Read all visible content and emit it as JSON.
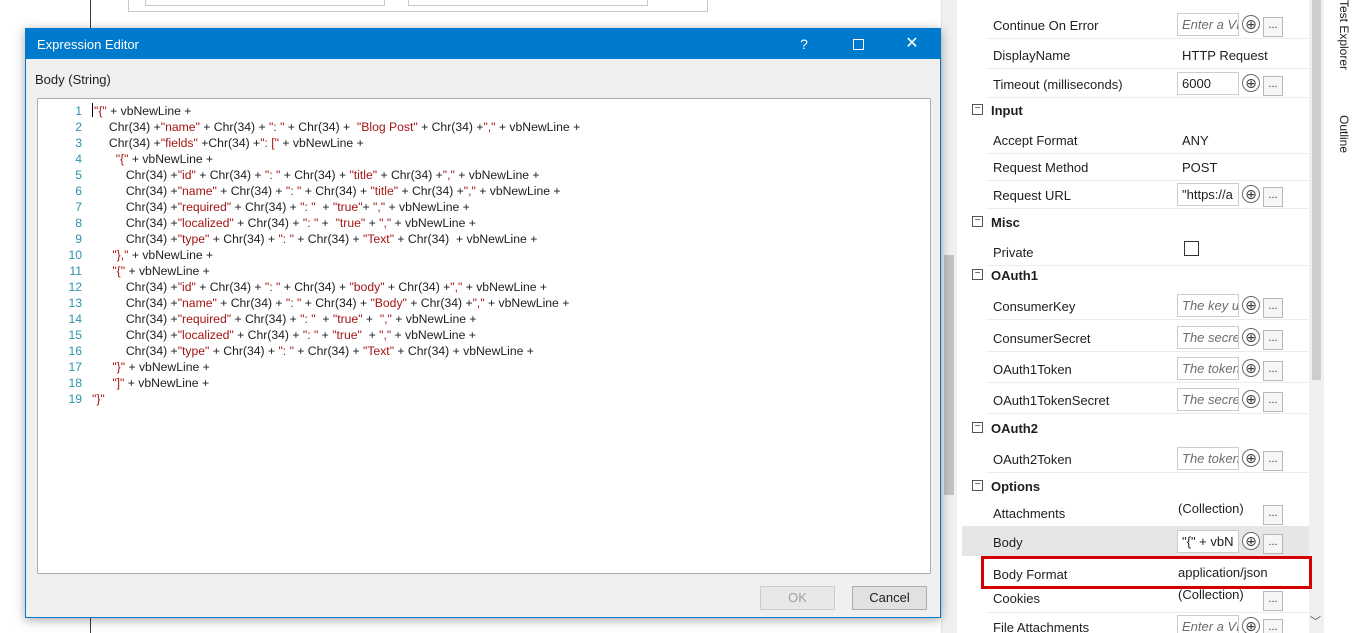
{
  "dialog": {
    "title": "Expression Editor",
    "help_label": "?",
    "close_label": "✕",
    "field_label": "Body (String)",
    "ok_label": "OK",
    "cancel_label": "Cancel"
  },
  "code_lines": [
    {
      "n": "1",
      "parts": [
        {
          "t": "\"{\"",
          "c": "s"
        },
        {
          "t": " + vbNewLine +",
          "c": "p"
        }
      ]
    },
    {
      "n": "2",
      "parts": [
        {
          "t": "     Chr(34) +",
          "c": "p"
        },
        {
          "t": "\"name\"",
          "c": "s"
        },
        {
          "t": " + Chr(34) + ",
          "c": "p"
        },
        {
          "t": "\": \"",
          "c": "s"
        },
        {
          "t": " + Chr(34) +  ",
          "c": "p"
        },
        {
          "t": "\"Blog Post\"",
          "c": "s"
        },
        {
          "t": " + Chr(34) +",
          "c": "p"
        },
        {
          "t": "\",\"",
          "c": "s"
        },
        {
          "t": " + vbNewLine +",
          "c": "p"
        }
      ]
    },
    {
      "n": "3",
      "parts": [
        {
          "t": "     Chr(34) +",
          "c": "p"
        },
        {
          "t": "\"fields\"",
          "c": "s"
        },
        {
          "t": " +Chr(34) +",
          "c": "p"
        },
        {
          "t": "\": [\"",
          "c": "s"
        },
        {
          "t": " + vbNewLine +",
          "c": "p"
        }
      ]
    },
    {
      "n": "4",
      "parts": [
        {
          "t": "       ",
          "c": "p"
        },
        {
          "t": "\"{\"",
          "c": "s"
        },
        {
          "t": " + vbNewLine +",
          "c": "p"
        }
      ]
    },
    {
      "n": "5",
      "parts": [
        {
          "t": "          Chr(34) +",
          "c": "p"
        },
        {
          "t": "\"id\"",
          "c": "s"
        },
        {
          "t": " + Chr(34) + ",
          "c": "p"
        },
        {
          "t": "\": \"",
          "c": "s"
        },
        {
          "t": " + Chr(34) + ",
          "c": "p"
        },
        {
          "t": "\"title\"",
          "c": "s"
        },
        {
          "t": " + Chr(34) +",
          "c": "p"
        },
        {
          "t": "\",\"",
          "c": "s"
        },
        {
          "t": " + vbNewLine +",
          "c": "p"
        }
      ]
    },
    {
      "n": "6",
      "parts": [
        {
          "t": "          Chr(34) +",
          "c": "p"
        },
        {
          "t": "\"name\"",
          "c": "s"
        },
        {
          "t": " + Chr(34) + ",
          "c": "p"
        },
        {
          "t": "\": \"",
          "c": "s"
        },
        {
          "t": " + Chr(34) + ",
          "c": "p"
        },
        {
          "t": "\"title\"",
          "c": "s"
        },
        {
          "t": " + Chr(34) +",
          "c": "p"
        },
        {
          "t": "\",\"",
          "c": "s"
        },
        {
          "t": " + vbNewLine +",
          "c": "p"
        }
      ]
    },
    {
      "n": "7",
      "parts": [
        {
          "t": "          Chr(34) +",
          "c": "p"
        },
        {
          "t": "\"required\"",
          "c": "s"
        },
        {
          "t": " + Chr(34) + ",
          "c": "p"
        },
        {
          "t": "\": \"",
          "c": "s"
        },
        {
          "t": "  + ",
          "c": "p"
        },
        {
          "t": "\"true\"",
          "c": "s"
        },
        {
          "t": "+ ",
          "c": "p"
        },
        {
          "t": "\",\"",
          "c": "s"
        },
        {
          "t": " + vbNewLine +",
          "c": "p"
        }
      ]
    },
    {
      "n": "8",
      "parts": [
        {
          "t": "          Chr(34) +",
          "c": "p"
        },
        {
          "t": "\"localized\"",
          "c": "s"
        },
        {
          "t": " + Chr(34) + ",
          "c": "p"
        },
        {
          "t": "\": \"",
          "c": "s"
        },
        {
          "t": " +  ",
          "c": "p"
        },
        {
          "t": "\"true\"",
          "c": "s"
        },
        {
          "t": " + ",
          "c": "p"
        },
        {
          "t": "\",\"",
          "c": "s"
        },
        {
          "t": " + vbNewLine +",
          "c": "p"
        }
      ]
    },
    {
      "n": "9",
      "parts": [
        {
          "t": "          Chr(34) +",
          "c": "p"
        },
        {
          "t": "\"type\"",
          "c": "s"
        },
        {
          "t": " + Chr(34) + ",
          "c": "p"
        },
        {
          "t": "\": \"",
          "c": "s"
        },
        {
          "t": " + Chr(34) + ",
          "c": "p"
        },
        {
          "t": "\"Text\"",
          "c": "s"
        },
        {
          "t": " + Chr(34)  + vbNewLine +",
          "c": "p"
        }
      ]
    },
    {
      "n": "10",
      "parts": [
        {
          "t": "      ",
          "c": "p"
        },
        {
          "t": "\"},\"",
          "c": "s"
        },
        {
          "t": " + vbNewLine +",
          "c": "p"
        }
      ]
    },
    {
      "n": "11",
      "parts": [
        {
          "t": "      ",
          "c": "p"
        },
        {
          "t": "\"{\"",
          "c": "s"
        },
        {
          "t": " + vbNewLine +",
          "c": "p"
        }
      ]
    },
    {
      "n": "12",
      "parts": [
        {
          "t": "          Chr(34) +",
          "c": "p"
        },
        {
          "t": "\"id\"",
          "c": "s"
        },
        {
          "t": " + Chr(34) + ",
          "c": "p"
        },
        {
          "t": "\": \"",
          "c": "s"
        },
        {
          "t": " + Chr(34) + ",
          "c": "p"
        },
        {
          "t": "\"body\"",
          "c": "s"
        },
        {
          "t": " + Chr(34) +",
          "c": "p"
        },
        {
          "t": "\",\"",
          "c": "s"
        },
        {
          "t": " + vbNewLine +",
          "c": "p"
        }
      ]
    },
    {
      "n": "13",
      "parts": [
        {
          "t": "          Chr(34) +",
          "c": "p"
        },
        {
          "t": "\"name\"",
          "c": "s"
        },
        {
          "t": " + Chr(34) + ",
          "c": "p"
        },
        {
          "t": "\": \"",
          "c": "s"
        },
        {
          "t": " + Chr(34) + ",
          "c": "p"
        },
        {
          "t": "\"Body\"",
          "c": "s"
        },
        {
          "t": " + Chr(34) +",
          "c": "p"
        },
        {
          "t": "\",\"",
          "c": "s"
        },
        {
          "t": " + vbNewLine +",
          "c": "p"
        }
      ]
    },
    {
      "n": "14",
      "parts": [
        {
          "t": "          Chr(34) +",
          "c": "p"
        },
        {
          "t": "\"required\"",
          "c": "s"
        },
        {
          "t": " + Chr(34) + ",
          "c": "p"
        },
        {
          "t": "\": \"",
          "c": "s"
        },
        {
          "t": "  + ",
          "c": "p"
        },
        {
          "t": "\"true\"",
          "c": "s"
        },
        {
          "t": " +  ",
          "c": "p"
        },
        {
          "t": "\",\"",
          "c": "s"
        },
        {
          "t": " + vbNewLine +",
          "c": "p"
        }
      ]
    },
    {
      "n": "15",
      "parts": [
        {
          "t": "          Chr(34) +",
          "c": "p"
        },
        {
          "t": "\"localized\"",
          "c": "s"
        },
        {
          "t": " + Chr(34) + ",
          "c": "p"
        },
        {
          "t": "\": \"",
          "c": "s"
        },
        {
          "t": " + ",
          "c": "p"
        },
        {
          "t": "\"true\"",
          "c": "s"
        },
        {
          "t": "  + ",
          "c": "p"
        },
        {
          "t": "\",\"",
          "c": "s"
        },
        {
          "t": " + vbNewLine +",
          "c": "p"
        }
      ]
    },
    {
      "n": "16",
      "parts": [
        {
          "t": "          Chr(34) +",
          "c": "p"
        },
        {
          "t": "\"type\"",
          "c": "s"
        },
        {
          "t": " + Chr(34) + ",
          "c": "p"
        },
        {
          "t": "\": \"",
          "c": "s"
        },
        {
          "t": " + Chr(34) + ",
          "c": "p"
        },
        {
          "t": "\"Text\"",
          "c": "s"
        },
        {
          "t": " + Chr(34) + vbNewLine +",
          "c": "p"
        }
      ]
    },
    {
      "n": "17",
      "parts": [
        {
          "t": "      ",
          "c": "p"
        },
        {
          "t": "\"}\"",
          "c": "s"
        },
        {
          "t": " + vbNewLine +",
          "c": "p"
        }
      ]
    },
    {
      "n": "18",
      "parts": [
        {
          "t": "      ",
          "c": "p"
        },
        {
          "t": "\"]\"",
          "c": "s"
        },
        {
          "t": " + vbNewLine +",
          "c": "p"
        }
      ]
    },
    {
      "n": "19",
      "parts": [
        {
          "t": "\"}\"",
          "c": "s"
        }
      ]
    }
  ],
  "properties": {
    "continue_on_error": {
      "label": "Continue On Error",
      "placeholder": "Enter a VB"
    },
    "display_name": {
      "label": "DisplayName",
      "value": "HTTP Request"
    },
    "timeout": {
      "label": "Timeout (milliseconds)",
      "value": "6000"
    },
    "cat_input": "Input",
    "accept_format": {
      "label": "Accept Format",
      "value": "ANY"
    },
    "request_method": {
      "label": "Request Method",
      "value": "POST"
    },
    "request_url": {
      "label": "Request URL",
      "value": "\"https://a"
    },
    "cat_misc": "Misc",
    "private": {
      "label": "Private"
    },
    "cat_oauth1": "OAuth1",
    "consumer_key": {
      "label": "ConsumerKey",
      "placeholder": "The key u"
    },
    "consumer_secret": {
      "label": "ConsumerSecret",
      "placeholder": "The secret"
    },
    "oauth1_token": {
      "label": "OAuth1Token",
      "placeholder": "The token"
    },
    "oauth1_token_secret": {
      "label": "OAuth1TokenSecret",
      "placeholder": "The secret"
    },
    "cat_oauth2": "OAuth2",
    "oauth2_token": {
      "label": "OAuth2Token",
      "placeholder": "The token"
    },
    "cat_options": "Options",
    "attachments": {
      "label": "Attachments",
      "value": "(Collection)"
    },
    "body": {
      "label": "Body",
      "value": "\"{\" + vbN"
    },
    "body_format": {
      "label": "Body Format",
      "value": "application/json"
    },
    "cookies": {
      "label": "Cookies",
      "value": "(Collection)"
    },
    "file_attachments": {
      "label": "File Attachments",
      "placeholder": "Enter a VB"
    },
    "plus_glyph": "⊕",
    "dots_glyph": "...",
    "toggle_glyph": "−"
  },
  "side_tabs": {
    "test_explorer": "Test Explorer",
    "outline": "Outline"
  },
  "colors": {
    "accent": "#007acc",
    "string": "#a31515",
    "line_number": "#2b91af",
    "highlight": "#d40000"
  }
}
